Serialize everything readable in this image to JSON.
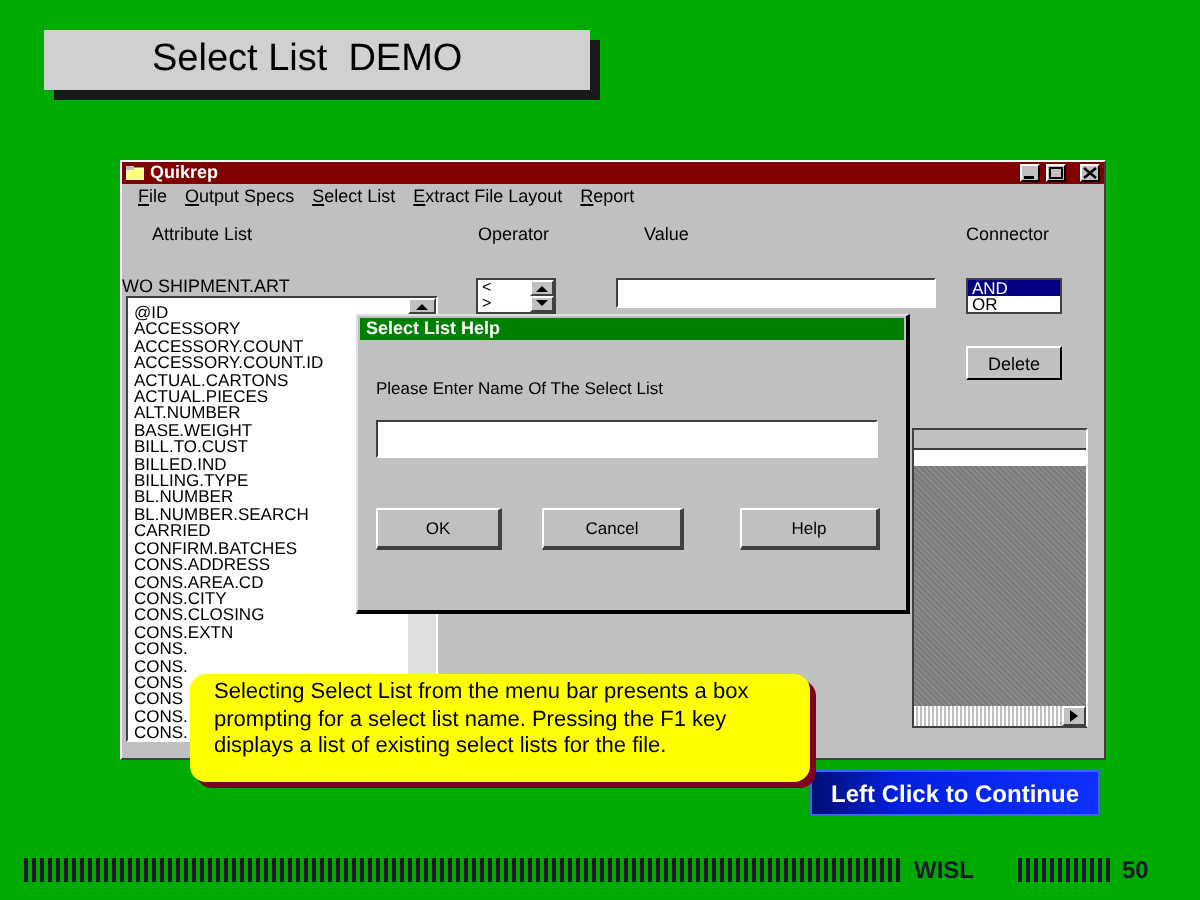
{
  "slide": {
    "title": "Select List  DEMO",
    "note": "Selecting Select List from the menu bar presents a box prompting for a select list name. Pressing the F1 key displays a list of existing select lists for the file.",
    "continue_button": "Left Click to Continue",
    "footer_label": "WISL",
    "page_number": "50"
  },
  "window": {
    "title": "Quikrep",
    "menu": [
      "File",
      "Output Specs",
      "Select List",
      "Extract File Layout",
      "Report"
    ],
    "columns": [
      "Attribute List",
      "Operator",
      "Value",
      "Connector"
    ],
    "file_label": "WO SHIPMENT.ART",
    "attributes": [
      "@ID",
      "ACCESSORY",
      "ACCESSORY.COUNT",
      "ACCESSORY.COUNT.ID",
      "ACTUAL.CARTONS",
      "ACTUAL.PIECES",
      "ALT.NUMBER",
      "BASE.WEIGHT",
      "BILL.TO.CUST",
      "BILLED.IND",
      "BILLING.TYPE",
      "BL.NUMBER",
      "BL.NUMBER.SEARCH",
      "CARRIED",
      "CONFIRM.BATCHES",
      "CONS.ADDRESS",
      "CONS.AREA.CD",
      "CONS.CITY",
      "CONS.CLOSING",
      "CONS.EXTN",
      "CONS.",
      "CONS.",
      "CONS",
      "CONS",
      "CONS.",
      "CONS."
    ],
    "operators": [
      "<",
      ">"
    ],
    "connectors": [
      {
        "label": "AND",
        "selected": true
      },
      {
        "label": "OR",
        "selected": false
      }
    ],
    "delete_button": "Delete"
  },
  "dialog": {
    "title": "Select List Help",
    "prompt": "Please Enter Name Of The Select List",
    "buttons": [
      "OK",
      "Cancel",
      "Help"
    ]
  }
}
